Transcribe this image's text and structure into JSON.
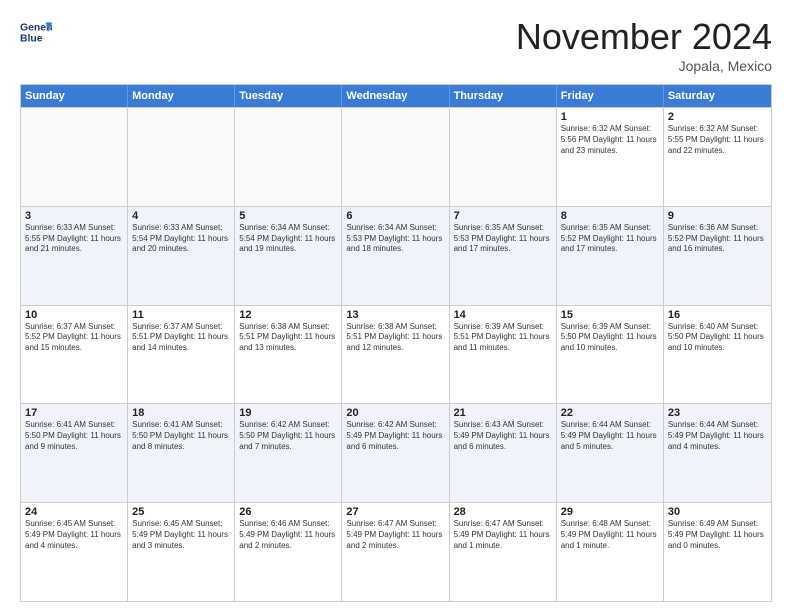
{
  "logo": {
    "line1": "General",
    "line2": "Blue"
  },
  "title": "November 2024",
  "location": "Jopala, Mexico",
  "days_header": [
    "Sunday",
    "Monday",
    "Tuesday",
    "Wednesday",
    "Thursday",
    "Friday",
    "Saturday"
  ],
  "rows": [
    [
      {
        "day": "",
        "info": ""
      },
      {
        "day": "",
        "info": ""
      },
      {
        "day": "",
        "info": ""
      },
      {
        "day": "",
        "info": ""
      },
      {
        "day": "",
        "info": ""
      },
      {
        "day": "1",
        "info": "Sunrise: 6:32 AM\nSunset: 5:56 PM\nDaylight: 11 hours and 23 minutes."
      },
      {
        "day": "2",
        "info": "Sunrise: 6:32 AM\nSunset: 5:55 PM\nDaylight: 11 hours and 22 minutes."
      }
    ],
    [
      {
        "day": "3",
        "info": "Sunrise: 6:33 AM\nSunset: 5:55 PM\nDaylight: 11 hours and 21 minutes."
      },
      {
        "day": "4",
        "info": "Sunrise: 6:33 AM\nSunset: 5:54 PM\nDaylight: 11 hours and 20 minutes."
      },
      {
        "day": "5",
        "info": "Sunrise: 6:34 AM\nSunset: 5:54 PM\nDaylight: 11 hours and 19 minutes."
      },
      {
        "day": "6",
        "info": "Sunrise: 6:34 AM\nSunset: 5:53 PM\nDaylight: 11 hours and 18 minutes."
      },
      {
        "day": "7",
        "info": "Sunrise: 6:35 AM\nSunset: 5:53 PM\nDaylight: 11 hours and 17 minutes."
      },
      {
        "day": "8",
        "info": "Sunrise: 6:35 AM\nSunset: 5:52 PM\nDaylight: 11 hours and 17 minutes."
      },
      {
        "day": "9",
        "info": "Sunrise: 6:36 AM\nSunset: 5:52 PM\nDaylight: 11 hours and 16 minutes."
      }
    ],
    [
      {
        "day": "10",
        "info": "Sunrise: 6:37 AM\nSunset: 5:52 PM\nDaylight: 11 hours and 15 minutes."
      },
      {
        "day": "11",
        "info": "Sunrise: 6:37 AM\nSunset: 5:51 PM\nDaylight: 11 hours and 14 minutes."
      },
      {
        "day": "12",
        "info": "Sunrise: 6:38 AM\nSunset: 5:51 PM\nDaylight: 11 hours and 13 minutes."
      },
      {
        "day": "13",
        "info": "Sunrise: 6:38 AM\nSunset: 5:51 PM\nDaylight: 11 hours and 12 minutes."
      },
      {
        "day": "14",
        "info": "Sunrise: 6:39 AM\nSunset: 5:51 PM\nDaylight: 11 hours and 11 minutes."
      },
      {
        "day": "15",
        "info": "Sunrise: 6:39 AM\nSunset: 5:50 PM\nDaylight: 11 hours and 10 minutes."
      },
      {
        "day": "16",
        "info": "Sunrise: 6:40 AM\nSunset: 5:50 PM\nDaylight: 11 hours and 10 minutes."
      }
    ],
    [
      {
        "day": "17",
        "info": "Sunrise: 6:41 AM\nSunset: 5:50 PM\nDaylight: 11 hours and 9 minutes."
      },
      {
        "day": "18",
        "info": "Sunrise: 6:41 AM\nSunset: 5:50 PM\nDaylight: 11 hours and 8 minutes."
      },
      {
        "day": "19",
        "info": "Sunrise: 6:42 AM\nSunset: 5:50 PM\nDaylight: 11 hours and 7 minutes."
      },
      {
        "day": "20",
        "info": "Sunrise: 6:42 AM\nSunset: 5:49 PM\nDaylight: 11 hours and 6 minutes."
      },
      {
        "day": "21",
        "info": "Sunrise: 6:43 AM\nSunset: 5:49 PM\nDaylight: 11 hours and 6 minutes."
      },
      {
        "day": "22",
        "info": "Sunrise: 6:44 AM\nSunset: 5:49 PM\nDaylight: 11 hours and 5 minutes."
      },
      {
        "day": "23",
        "info": "Sunrise: 6:44 AM\nSunset: 5:49 PM\nDaylight: 11 hours and 4 minutes."
      }
    ],
    [
      {
        "day": "24",
        "info": "Sunrise: 6:45 AM\nSunset: 5:49 PM\nDaylight: 11 hours and 4 minutes."
      },
      {
        "day": "25",
        "info": "Sunrise: 6:45 AM\nSunset: 5:49 PM\nDaylight: 11 hours and 3 minutes."
      },
      {
        "day": "26",
        "info": "Sunrise: 6:46 AM\nSunset: 5:49 PM\nDaylight: 11 hours and 2 minutes."
      },
      {
        "day": "27",
        "info": "Sunrise: 6:47 AM\nSunset: 5:49 PM\nDaylight: 11 hours and 2 minutes."
      },
      {
        "day": "28",
        "info": "Sunrise: 6:47 AM\nSunset: 5:49 PM\nDaylight: 11 hours and 1 minute."
      },
      {
        "day": "29",
        "info": "Sunrise: 6:48 AM\nSunset: 5:49 PM\nDaylight: 11 hours and 1 minute."
      },
      {
        "day": "30",
        "info": "Sunrise: 6:49 AM\nSunset: 5:49 PM\nDaylight: 11 hours and 0 minutes."
      }
    ]
  ]
}
